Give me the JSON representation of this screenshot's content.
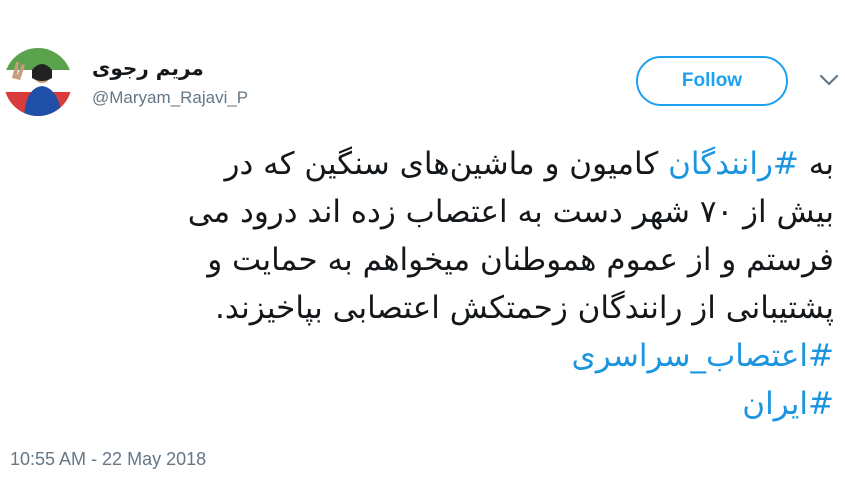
{
  "author": {
    "name": "مریم رجوی",
    "handle": "@Maryam_Rajavi_P",
    "avatar_icon": "profile-photo-avatar"
  },
  "follow_button": {
    "label": "Follow",
    "color": "#1da1f2"
  },
  "menu_icon": "chevron-down-icon",
  "tweet": {
    "lines": [
      [
        "به ",
        {
          "hashtag": "#رانندگان"
        },
        " کامیون و ماشین‌های سنگین که در"
      ],
      [
        "بیش از ۷۰ شهر دست به اعتصاب زده اند درود می"
      ],
      [
        "فرستم و از عموم هموطنان میخواهم به حمایت و"
      ],
      [
        "پشتیبانی از رانندگان زحمتکش اعتصابی بپاخیزند."
      ],
      [
        {
          "hashtag": "#اعتصاب_سراسری"
        }
      ],
      [
        {
          "hashtag": "#ایران"
        }
      ]
    ],
    "hashtag_color": "#1b95e0"
  },
  "timestamp": "10:55 AM - 22 May 2018"
}
